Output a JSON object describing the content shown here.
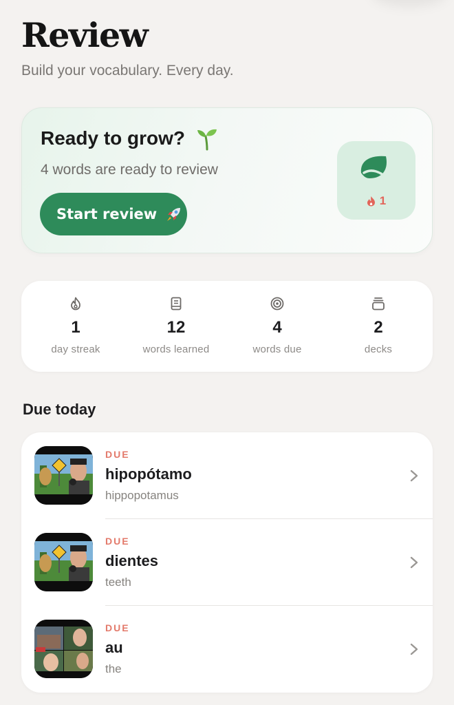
{
  "header": {
    "title": "Review",
    "subtitle": "Build your vocabulary. Every day."
  },
  "hero": {
    "title": "Ready to grow?",
    "title_emoji_icon": "sprout-icon",
    "subtitle": "4 words are ready to review",
    "button_label": "Start review",
    "button_icon": "rocket-icon",
    "badge_icon": "leaf-icon",
    "badge_streak_icon": "flame-icon",
    "badge_streak": "1",
    "accent_color": "#2e8b5a"
  },
  "stats": [
    {
      "icon": "flame-icon",
      "value": "1",
      "label": "day streak"
    },
    {
      "icon": "book-icon",
      "value": "12",
      "label": "words learned"
    },
    {
      "icon": "target-icon",
      "value": "4",
      "label": "words due"
    },
    {
      "icon": "stack-icon",
      "value": "2",
      "label": "decks"
    }
  ],
  "due_section": {
    "title": "Due today",
    "items": [
      {
        "tag": "DUE",
        "word": "hipopótamo",
        "translation": "hippopotamus",
        "thumbnail": "video-thumbnail"
      },
      {
        "tag": "DUE",
        "word": "dientes",
        "translation": "teeth",
        "thumbnail": "video-thumbnail"
      },
      {
        "tag": "DUE",
        "word": "au",
        "translation": "the",
        "thumbnail": "video-thumbnail"
      }
    ],
    "tag_color": "#e37a6b"
  }
}
